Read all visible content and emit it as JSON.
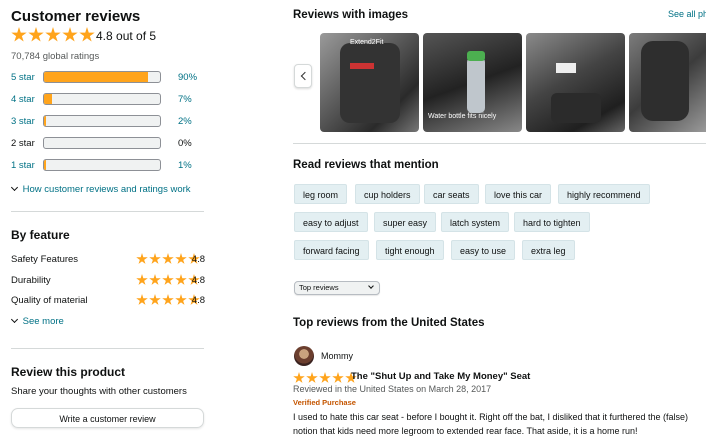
{
  "summary": {
    "title": "Customer reviews",
    "rating_text": "4.8 out of 5",
    "rating_value": 4.8,
    "global_ratings": "70,784 global ratings",
    "histogram": [
      {
        "label": "5 star",
        "percent_text": "90%",
        "percent": 90
      },
      {
        "label": "4 star",
        "percent_text": "7%",
        "percent": 7
      },
      {
        "label": "3 star",
        "percent_text": "2%",
        "percent": 2
      },
      {
        "label": "2 star",
        "percent_text": "0%",
        "percent": 0
      },
      {
        "label": "1 star",
        "percent_text": "1%",
        "percent": 1
      }
    ],
    "how_work_link": "How customer reviews and ratings work"
  },
  "by_feature": {
    "title": "By feature",
    "items": [
      {
        "name": "Safety Features",
        "value": "4.8"
      },
      {
        "name": "Durability",
        "value": "4.8"
      },
      {
        "name": "Quality of material",
        "value": "4.8"
      }
    ],
    "see_more": "See more"
  },
  "review_product": {
    "title": "Review this product",
    "subtitle": "Share your thoughts with other customers",
    "button": "Write a customer review"
  },
  "images": {
    "title": "Reviews with images",
    "see_all": "See all ph",
    "captions": [
      "Extend2Fit",
      "Water bottle fits nicely",
      "",
      ""
    ]
  },
  "mentions": {
    "title": "Read reviews that mention",
    "rows": [
      [
        "leg room",
        "cup holders",
        "car seats",
        "love this car",
        "highly recommend"
      ],
      [
        "easy to adjust",
        "super easy",
        "latch system",
        "hard to tighten"
      ],
      [
        "forward facing",
        "tight enough",
        "easy to use",
        "extra leg"
      ]
    ]
  },
  "sort": {
    "selected": "Top reviews"
  },
  "top_reviews": {
    "title": "Top reviews from the United States",
    "review": {
      "author": "Mommy",
      "stars": 5,
      "headline": "The \"Shut Up and Take My Money\" Seat",
      "meta": "Reviewed in the United States on March 28, 2017",
      "verified": "Verified Purchase",
      "body_line1": "I used to hate this car seat - before I bought it. Right off the bat, I disliked that it furthered the (false)",
      "body_line2": "notion that kids need more legroom to extended rear face. That aside, it is a home run!"
    }
  },
  "colors": {
    "star": "#ffa41c",
    "link": "#007185",
    "verified": "#c45500",
    "chip_bg": "#e3eff2"
  }
}
